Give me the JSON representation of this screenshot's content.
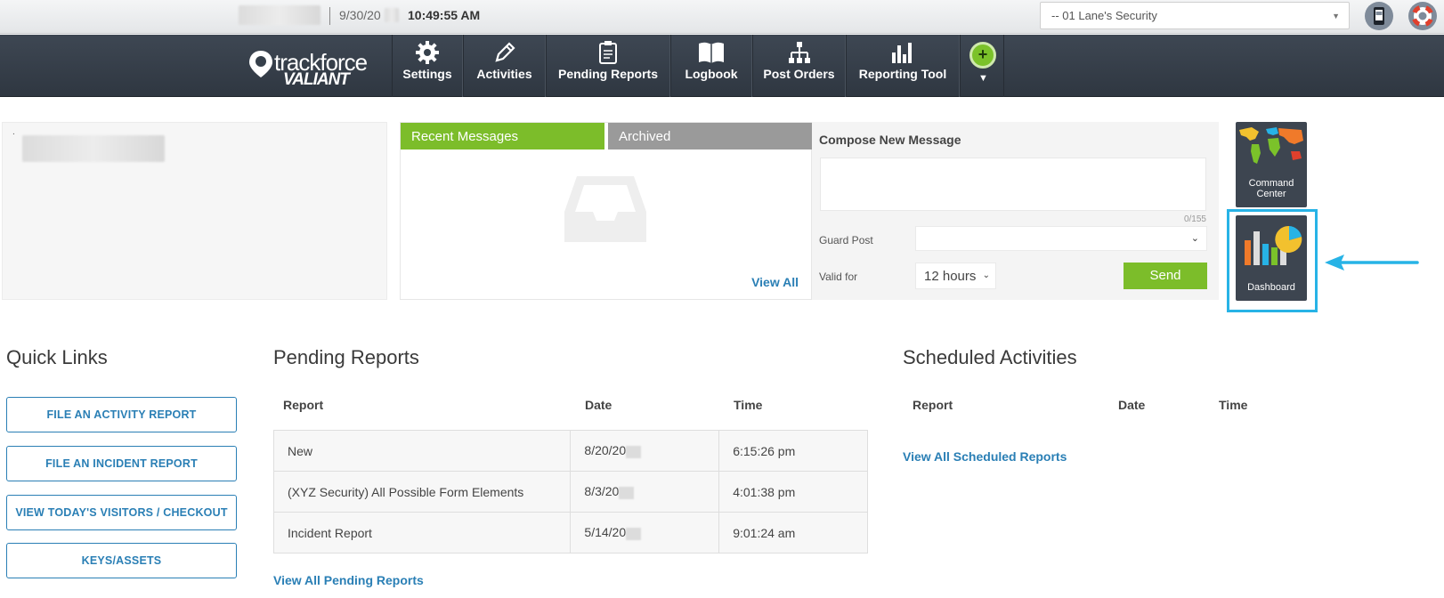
{
  "topbar": {
    "date": "9/30/20",
    "time": "10:49:55 AM",
    "company": "-- 01 Lane's Security"
  },
  "nav": {
    "logo_line1": "trackforce",
    "logo_line2": "VALIANT",
    "items": [
      {
        "label": "Settings",
        "icon": "gear-icon"
      },
      {
        "label": "Activities",
        "icon": "pencil-icon"
      },
      {
        "label": "Pending Reports",
        "icon": "clipboard-icon"
      },
      {
        "label": "Logbook",
        "icon": "book-icon"
      },
      {
        "label": "Post Orders",
        "icon": "org-chart-icon"
      },
      {
        "label": "Reporting Tool",
        "icon": "bar-chart-icon"
      }
    ],
    "plus_symbol": "+",
    "caret_symbol": "▼"
  },
  "messages": {
    "tab_recent": "Recent Messages",
    "tab_archived": "Archived",
    "view_all": "View All"
  },
  "compose": {
    "title": "Compose New Message",
    "counter": "0/155",
    "guard_post_label": "Guard Post",
    "guard_post_value": "",
    "valid_for_label": "Valid for",
    "valid_for_value": "12 hours",
    "send_label": "Send"
  },
  "tiles": {
    "command_center": "Command Center",
    "dashboard": "Dashboard"
  },
  "quick_links": {
    "title": "Quick Links",
    "buttons": [
      "FILE AN ACTIVITY REPORT",
      "FILE AN INCIDENT REPORT",
      "VIEW TODAY'S VISITORS / CHECKOUT",
      "KEYS/ASSETS"
    ]
  },
  "pending_reports": {
    "title": "Pending Reports",
    "columns": [
      "Report",
      "Date",
      "Time"
    ],
    "rows": [
      {
        "report": "New",
        "date": "8/20/20",
        "time": "6:15:26 pm"
      },
      {
        "report": "(XYZ Security) All Possible Form Elements",
        "date": "8/3/20",
        "time": "4:01:38 pm"
      },
      {
        "report": "Incident Report",
        "date": "5/14/20",
        "time": "9:01:24 am"
      }
    ],
    "view_all": "View All Pending Reports"
  },
  "scheduled_activities": {
    "title": "Scheduled Activities",
    "columns": [
      "Report",
      "Date",
      "Time"
    ],
    "view_all": "View All Scheduled Reports"
  },
  "colors": {
    "accent_green": "#7cbd2a",
    "link_blue": "#2a7fb5",
    "nav_dark": "#36404b",
    "highlight_cyan": "#27b3e6"
  }
}
